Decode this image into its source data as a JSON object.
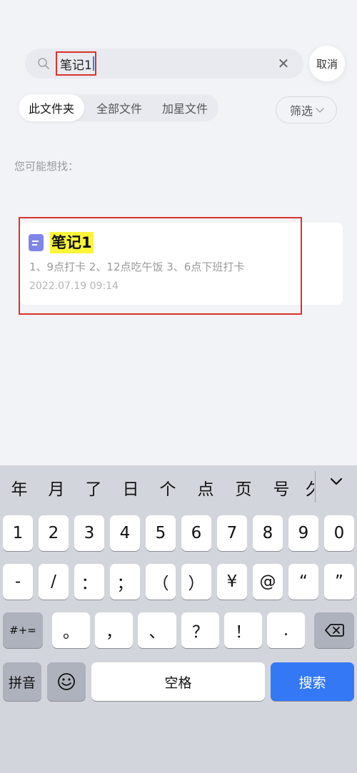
{
  "search": {
    "query": "笔记1",
    "cancel_label": "取消"
  },
  "tabs": [
    {
      "label": "此文件夹",
      "active": true
    },
    {
      "label": "全部文件",
      "active": false
    },
    {
      "label": "加星文件",
      "active": false
    }
  ],
  "filter_label": "筛选",
  "suggest_label": "您可能想找：",
  "result": {
    "title": "笔记1",
    "snippet": "1、9点打卡 2、12点吃午饭 3、6点下班打卡",
    "date": "2022.07.19 09:14"
  },
  "keyboard": {
    "candidates": [
      "年",
      "月",
      "了",
      "日",
      "个",
      "点",
      "页",
      "号",
      "久"
    ],
    "row_numbers": [
      "1",
      "2",
      "3",
      "4",
      "5",
      "6",
      "7",
      "8",
      "9",
      "0"
    ],
    "row_symbols": [
      "-",
      "/",
      "：",
      "；",
      "（",
      "）",
      "¥",
      "@",
      "“",
      "”"
    ],
    "row_punct": [
      "。",
      "，",
      "、",
      "？",
      "！",
      "."
    ],
    "more_symbols_label": "#+=",
    "pinyin_label": "拼音",
    "space_label": "空格",
    "search_label": "搜索"
  }
}
